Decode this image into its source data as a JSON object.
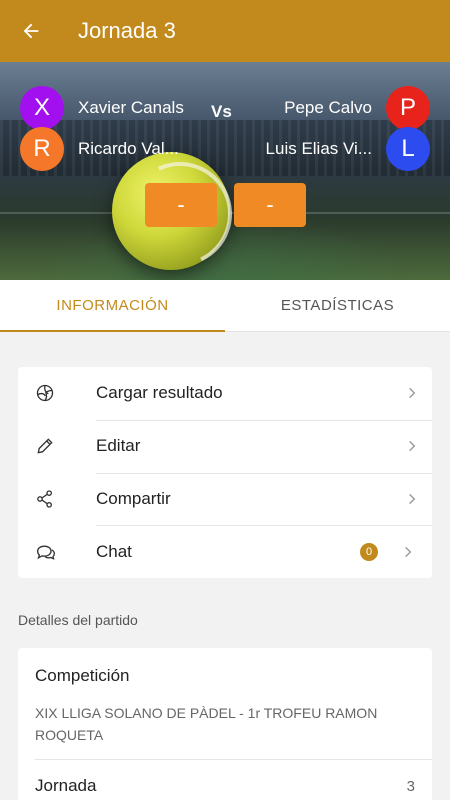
{
  "appbar": {
    "title": "Jornada 3",
    "back_icon": "arrow-left-icon"
  },
  "match": {
    "vs_label": "Vs",
    "team_left": [
      {
        "initial": "X",
        "name": "Xavier Canals",
        "color": "#a310f0"
      },
      {
        "initial": "R",
        "name": "Ricardo Val...",
        "color": "#f5782a"
      }
    ],
    "team_right": [
      {
        "initial": "P",
        "name": "Pepe Calvo",
        "color": "#e8231b"
      },
      {
        "initial": "L",
        "name": "Luis Elias Vi...",
        "color": "#2c4cf0"
      }
    ],
    "score_left": "-",
    "score_right": "-"
  },
  "tabs": [
    {
      "label": "INFORMACIÓN",
      "active": true
    },
    {
      "label": "ESTADÍSTICAS",
      "active": false
    }
  ],
  "menu": {
    "items": [
      {
        "label": "Cargar resultado",
        "icon": "volleyball-icon"
      },
      {
        "label": "Editar",
        "icon": "pencil-icon"
      },
      {
        "label": "Compartir",
        "icon": "share-icon"
      },
      {
        "label": "Chat",
        "icon": "chat-icon",
        "badge": "0"
      }
    ]
  },
  "details": {
    "section_label": "Detalles del partido",
    "competition_label": "Competición",
    "competition_value": "XIX LLIGA SOLANO DE PÀDEL - 1r TROFEU RAMON ROQUETA",
    "round_label": "Jornada",
    "round_value": "3"
  },
  "colors": {
    "accent": "#c28a1c",
    "score_button": "#f08a24",
    "background": "#f2f2f2"
  }
}
